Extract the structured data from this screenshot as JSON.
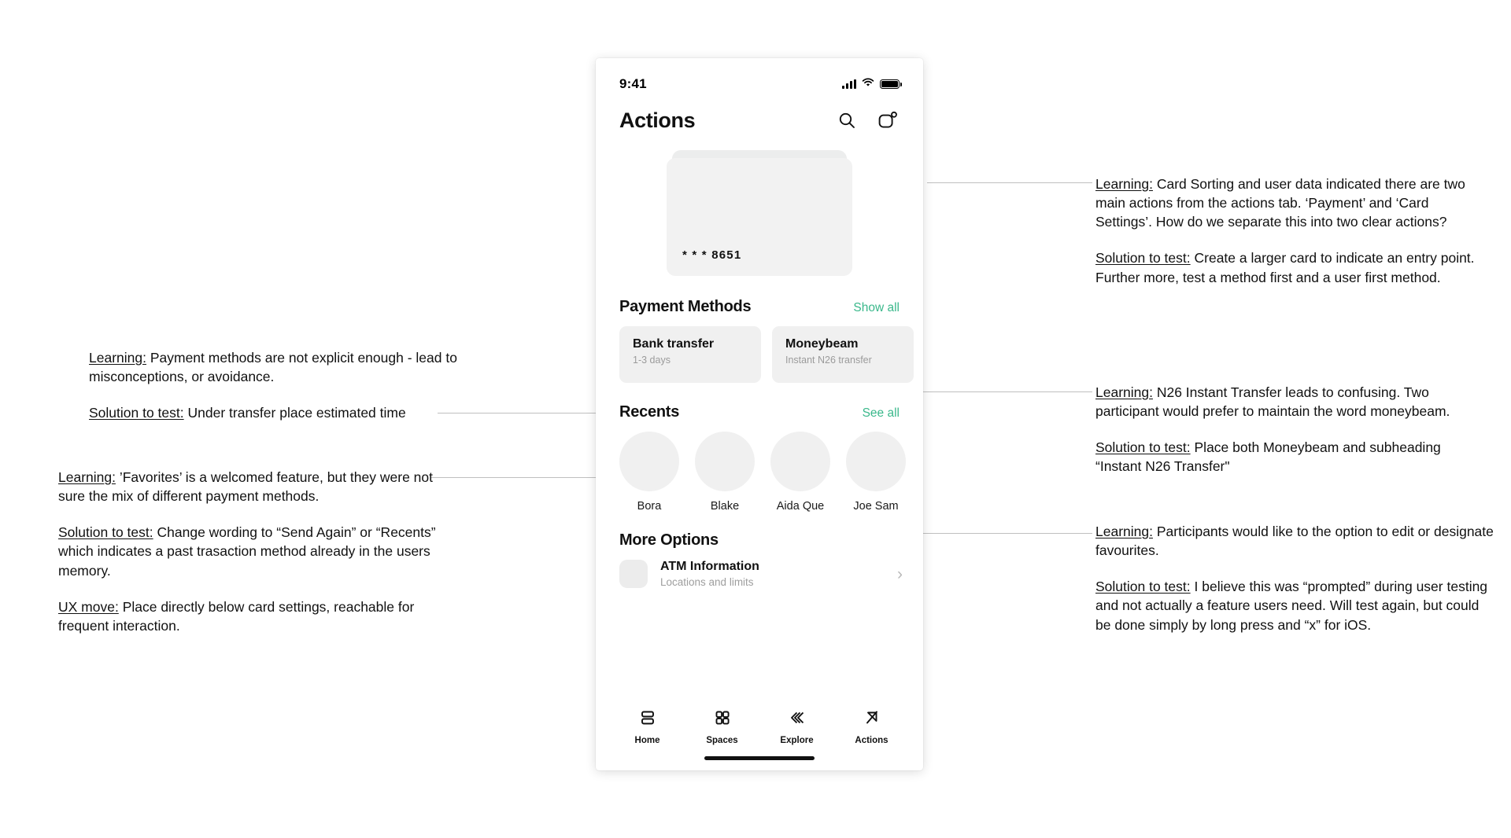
{
  "phone": {
    "status_bar": {
      "time": "9:41",
      "signal_icon": "cellular-signal-icon",
      "wifi_icon": "wifi-icon",
      "battery_icon": "battery-full-icon"
    },
    "header": {
      "title": "Actions",
      "search_icon": "search-icon",
      "card_icon": "card-notification-icon"
    },
    "card": {
      "number": "* * * 8651"
    },
    "payment_methods": {
      "title": "Payment Methods",
      "show_all": "Show all",
      "items": [
        {
          "name": "Bank transfer",
          "sub": "1-3 days"
        },
        {
          "name": "Moneybeam",
          "sub": "Instant N26 transfer"
        }
      ]
    },
    "recents": {
      "title": "Recents",
      "see_all": "See all",
      "people": [
        {
          "name": "Bora"
        },
        {
          "name": "Blake"
        },
        {
          "name": "Aida Que"
        },
        {
          "name": "Joe Sam"
        }
      ]
    },
    "more_options": {
      "title": "More Options",
      "rows": [
        {
          "title": "ATM Information",
          "sub": "Locations and limits",
          "chevron": "›"
        }
      ]
    },
    "tabbar": {
      "tabs": [
        {
          "label": "Home",
          "icon": "home-rows-icon"
        },
        {
          "label": "Spaces",
          "icon": "grid-squares-icon"
        },
        {
          "label": "Explore",
          "icon": "stacked-chevrons-icon"
        },
        {
          "label": "Actions",
          "icon": "actions-arrow-icon"
        }
      ]
    },
    "colors": {
      "accent_green": "#3ab88b",
      "surface_gray": "#f0f0f0",
      "muted_text": "#9b9b9b"
    }
  },
  "annotations": {
    "left": [
      {
        "learning_label": "Learning:",
        "learning_text": " Payment methods are not explicit enough - lead to misconceptions, or avoidance.",
        "solution_label": "Solution to test:",
        "solution_text": " Under transfer place estimated time"
      },
      {
        "learning_label": "Learning:",
        "learning_text": " ’Favorites’ is a welcomed feature, but they were not sure the mix of different payment methods.",
        "solution_label": "Solution to test:",
        "solution_text": " Change wording to “Send Again” or “Recents” which indicates a past trasaction method already in the users memory.",
        "ux_label": "UX move:",
        "ux_text": " Place directly below card settings, reachable for frequent interaction."
      }
    ],
    "right": [
      {
        "learning_label": "Learning:",
        "learning_text": " Card Sorting and user data indicated there are two main actions from the actions tab. ‘Payment’ and ‘Card Settings’. How do we separate this into two clear actions?",
        "solution_label": "Solution to test:",
        "solution_text": " Create a larger card to indicate an entry point. Further more, test a method first and a user first method."
      },
      {
        "learning_label": "Learning:",
        "learning_text": " N26 Instant Transfer leads to confusing. Two participant would prefer to maintain the word moneybeam.",
        "solution_label": "Solution to test:",
        "solution_text": " Place both Moneybeam and subheading “Instant N26 Transfer\""
      },
      {
        "learning_label": "Learning:",
        "learning_text": " Participants would like to the option to edit or designate favourites.",
        "solution_label": "Solution to test:",
        "solution_text": " I believe this was “prompted” during user testing and not actually a feature users need. Will test again, but could be done simply by long press and “x” for iOS."
      }
    ]
  }
}
